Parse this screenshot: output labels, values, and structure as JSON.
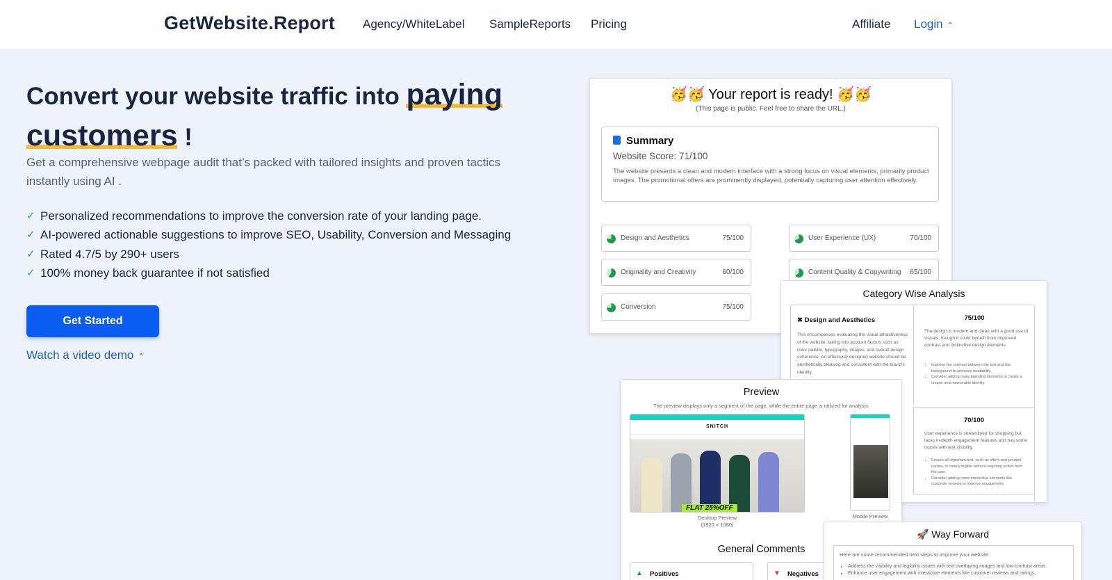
{
  "nav": {
    "brand": "GetWebsite.Report",
    "links": [
      "Agency/WhiteLabel",
      "SampleReports",
      "Pricing"
    ],
    "affiliate": "Affiliate",
    "login": "Login",
    "login_caret": "⌃"
  },
  "hero": {
    "title_lead": "Convert your website traffic into ",
    "title_highlight_1": "paying",
    "title_highlight_2": "customers",
    "title_end": " !",
    "subtitle": "Get a comprehensive webpage audit that’s packed with tailored insights and proven tactics instantly using AI .",
    "features": [
      "Personalized recommendations to improve the conversion rate of your landing page.",
      "AI-powered actionable suggestions to improve SEO, Usability, Conversion and Messaging",
      "Rated 4.7/5 by 290+ users",
      "100% money back guarantee if not satisfied"
    ],
    "cta": "Get Started",
    "demo": "Watch a video demo",
    "demo_caret": "⌃"
  },
  "report": {
    "title": "🥳🥳 Your report is ready! 🥳🥳",
    "note": "(This page is public. Feel free to share the URL.)",
    "summary_title": "Summary",
    "score": "Website Score: 71/100",
    "summary_text": "The website presents a clean and modern interface with a strong focus on visual elements, primarily product images. The promotional offers are prominently displayed, potentially capturing user attention effectively.",
    "categories": [
      {
        "name": "Design and Aesthetics",
        "score": "75/100",
        "fill": 0.75
      },
      {
        "name": "User Experience (UX)",
        "score": "70/100",
        "fill": 0.7
      },
      {
        "name": "Originality and Creativity",
        "score": "60/100",
        "fill": 0.6
      },
      {
        "name": "Content Quality & Copywriting",
        "score": "65/100",
        "fill": 0.65
      },
      {
        "name": "Conversion",
        "score": "75/100",
        "fill": 0.75
      }
    ]
  },
  "category_analysis": {
    "title": "Category Wise Analysis",
    "head": "Design and Aesthetics",
    "text": "This encompasses evaluating the visual attractiveness of the website, taking into account factors such as color palette, typography, images, and overall design coherence. An effectively designed website should be aesthetically pleasing and consistent with the brand's identity.",
    "score1": "75/100",
    "desc1": "The design is modern and clean with a good use of visuals, though it could benefit from improved contrast and distinctive design elements.",
    "bullets1": [
      "Improve the contrast between the text and the background to enhance readability.",
      "Consider adding more branding elements to create a unique and memorable identity."
    ],
    "score2": "70/100",
    "desc2": "User experience is streamlined for shopping but lacks in-depth engagement features and has some issues with text visibility.",
    "bullets2": [
      "Ensure all important text, such as offers and product names, is clearly legible without requiring action from the user.",
      "Consider adding more interactive elements like customer reviews to improve engagement."
    ]
  },
  "preview": {
    "title": "Preview",
    "note": "The preview displays only a segment of the page, while the entire page is utilized for analysis.",
    "logo": "SNITCH",
    "banner": "FLAT 25%OFF",
    "desktop_caption": "Desktop Preview",
    "desktop_size": "(1920 × 1080)",
    "mobile_caption": "Mobile Preview",
    "general_comments": "General Comments",
    "positives": "Positives",
    "negatives": "Negatives"
  },
  "way_forward": {
    "title": "Way Forward",
    "text": "Here are some recommended next steps to improve your website.",
    "bullets": [
      "Address the visibility and legibility issues with text overlaying images and low-contrast areas.",
      "Enhance user engagement with interactive elements like customer reviews and ratings."
    ]
  },
  "colors": {
    "accent": "#0b5cf1",
    "link": "#1f5fc4",
    "highlight": "#f5b731",
    "check": "#26a661",
    "bg": "#eef2fb"
  }
}
